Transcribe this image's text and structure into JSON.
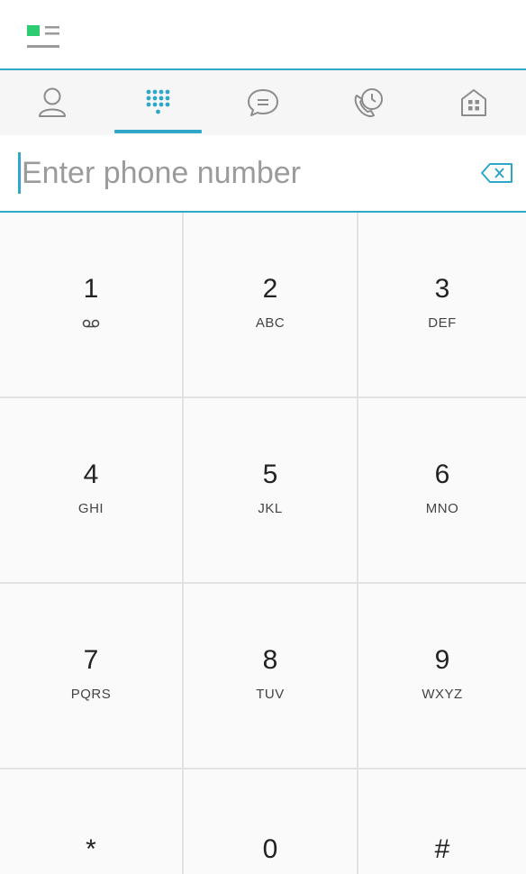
{
  "header": {
    "menu_icon": "menu-list-icon",
    "accent_color": "#2ea7c9",
    "logo_color": "#2ecc71"
  },
  "tabs": [
    {
      "icon": "contact-person-icon",
      "active": false
    },
    {
      "icon": "dialpad-icon",
      "active": true
    },
    {
      "icon": "message-bubble-icon",
      "active": false
    },
    {
      "icon": "call-history-icon",
      "active": false
    },
    {
      "icon": "directory-building-icon",
      "active": false
    }
  ],
  "input": {
    "value": "",
    "placeholder": "Enter phone number",
    "clear_icon": "backspace-icon"
  },
  "keypad": [
    {
      "digit": "1",
      "letters": "",
      "icon": "voicemail-icon"
    },
    {
      "digit": "2",
      "letters": "ABC"
    },
    {
      "digit": "3",
      "letters": "DEF"
    },
    {
      "digit": "4",
      "letters": "GHI"
    },
    {
      "digit": "5",
      "letters": "JKL"
    },
    {
      "digit": "6",
      "letters": "MNO"
    },
    {
      "digit": "7",
      "letters": "PQRS"
    },
    {
      "digit": "8",
      "letters": "TUV"
    },
    {
      "digit": "9",
      "letters": "WXYZ"
    },
    {
      "digit": "*",
      "letters": ""
    },
    {
      "digit": "0",
      "letters": ""
    },
    {
      "digit": "#",
      "letters": ""
    }
  ]
}
